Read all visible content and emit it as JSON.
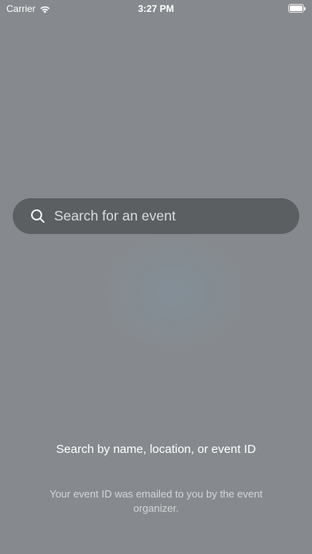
{
  "status_bar": {
    "carrier": "Carrier",
    "time": "3:27 PM",
    "wifi_icon": "wifi-icon",
    "battery_icon": "battery-full-icon"
  },
  "search": {
    "placeholder": "Search for an event",
    "value": "",
    "icon": "magnifying-glass-icon"
  },
  "hint": {
    "title": "Search by name, location, or event ID",
    "subtitle": "Your event ID was emailed to you by the event organizer."
  },
  "colors": {
    "background": "#868a8e",
    "search_field": "#5c5f62",
    "text_primary": "#ffffff",
    "text_secondary": "#d3d5d7"
  }
}
